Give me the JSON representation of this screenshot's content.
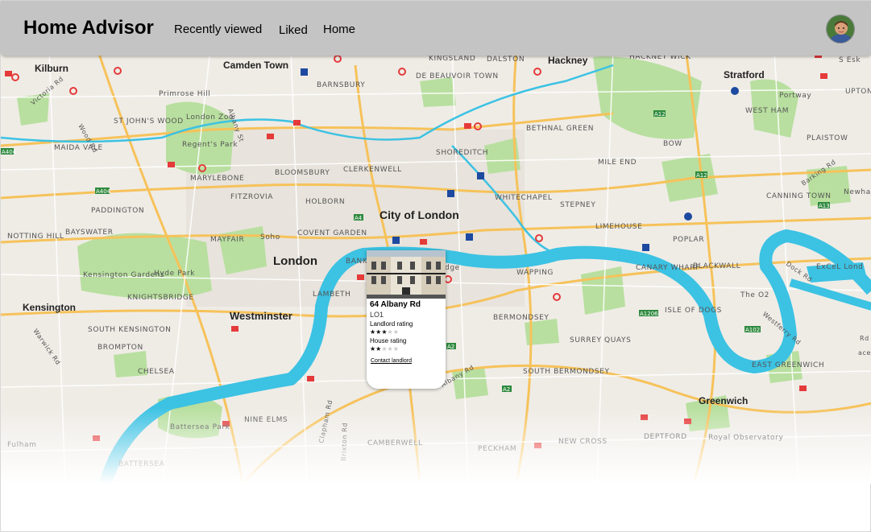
{
  "header": {
    "brand": "Home Advisor",
    "nav": [
      "Recently viewed",
      "Liked",
      "Home"
    ],
    "avatar_icon": "user-avatar"
  },
  "map": {
    "labels": {
      "kilburn": "Kilburn",
      "camden_town": "Camden Town",
      "kingsland": "KINGSLAND",
      "dalston": "DALSTON",
      "hackney": "Hackney",
      "hackney_wick": "HACKNEY WICK",
      "stratford": "Stratford",
      "s_esk": "S Esk",
      "barnsbury": "BARNSBURY",
      "de_beauvoir": "DE BEAUVOIR TOWN",
      "primrose_hill": "Primrose Hill",
      "london_zoo": "London Zoo",
      "regents_park": "Regent's Park",
      "st_johns_wood": "ST JOHN'S WOOD",
      "maida_vale": "MAIDA VALE",
      "bethnal_green": "BETHNAL GREEN",
      "bow": "BOW",
      "west_ham": "WEST HAM",
      "plaistow": "PLAISTOW",
      "upton_park": "UPTON PARK",
      "portway": "Portway",
      "shoreditch": "SHOREDITCH",
      "mile_end": "MILE END",
      "marylebone": "MARYLEBONE",
      "bloomsbury": "BLOOMSBURY",
      "clerkenwell": "CLERKENWELL",
      "fitzrovia": "FITZROVIA",
      "holborn": "HOLBORN",
      "whitechapel": "WHITECHAPEL",
      "stepney": "STEPNEY",
      "canning_town": "CANNING TOWN",
      "newham": "Newham",
      "paddington": "PADDINGTON",
      "city_of_london": "City of London",
      "limehouse": "LIMEHOUSE",
      "poplar": "POPLAR",
      "notting_hill": "NOTTING HILL",
      "bayswater": "BAYSWATER",
      "mayfair": "MAYFAIR",
      "soho": "Soho",
      "covent_garden": "COVENT GARDEN",
      "london": "London",
      "wapping": "WAPPING",
      "canary_wharf": "CANARY WHARF",
      "blackwall": "BLACKWALL",
      "excel": "ExCeL Lond",
      "kensington_gardens": "Kensington Gardens",
      "hyde_park": "Hyde Park",
      "knightsbridge": "KNIGHTSBRIDGE",
      "lambeth": "LAMBETH",
      "the_o2": "The O2",
      "kensington": "Kensington",
      "westminster": "Westminster",
      "south_kensington": "SOUTH KENSINGTON",
      "bermondsey": "BERMONDSEY",
      "isle_of_dogs": "ISLE OF DOGS",
      "brompton": "BROMPTON",
      "surrey_quays": "SURREY QUAYS",
      "chelsea": "CHELSEA",
      "south_bermondsey": "SOUTH BERMONDSEY",
      "east_greenwich": "EAST GREENWICH",
      "battersea_park": "Battersea Park",
      "nine_elms": "NINE ELMS",
      "greenwich": "Greenwich",
      "fulham": "Fulham",
      "camberwell": "CAMBERWELL",
      "peckham": "PECKHAM",
      "new_cross": "NEW CROSS",
      "deptford": "DEPTFORD",
      "royal_observatory": "Royal Observatory",
      "battersea": "BATTERSEA",
      "bank": "BANK",
      "edge": "dge"
    },
    "roads": {
      "a404": "A404",
      "a4": "A4",
      "a12": "A12",
      "a13": "A13",
      "a1206": "A1206",
      "a102": "A102",
      "a2": "A2",
      "victoria_rd": "Victoria Rd",
      "portway": "Portway",
      "albany_st": "Albany St",
      "albany_rd": "Albany Rd",
      "clapham_rd": "Clapham Rd",
      "brixton_rd": "Brixton Rd",
      "barking_rd": "Barking Rd",
      "dock_rd": "Dock Rd",
      "wood_rd": "Wood Rd",
      "westferry_rd": "Westferry Rd",
      "warwick_rd": "Warwick Rd",
      "road_fragment": "Rd",
      "road_fragment2": "ace"
    }
  },
  "card": {
    "photo_icon": "house-photo",
    "address": "64 Albany Rd",
    "postcode": "LO1",
    "landlord_label": "Landlord rating",
    "landlord_rating": 3,
    "house_label": "House rating",
    "house_rating": 2,
    "max_rating": 5,
    "contact": "Contact landlord"
  },
  "colors": {
    "header": "#c4c4c4",
    "water": "#3cc2e3",
    "park": "#b8df9f",
    "road_major": "#f6c25a",
    "land": "#efece6"
  }
}
